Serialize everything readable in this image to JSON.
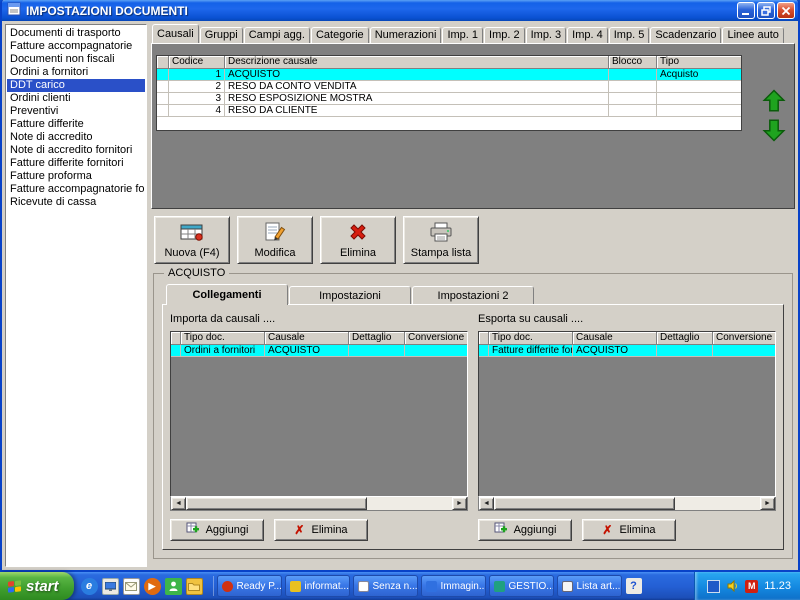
{
  "colors": {
    "selection_cyan": "#00ffff",
    "sidebar_selected_blue": "#2a50c8",
    "panel_gray": "#d4d0c8",
    "grid_empty_gray": "#808080",
    "titlebar_blue": "#1461e8",
    "arrow_green": "#1fa31f",
    "delete_red": "#c41200",
    "start_green": "#3f9e2e"
  },
  "window": {
    "title": "IMPOSTAZIONI DOCUMENTI"
  },
  "sidebar": {
    "selected_item": "DDT carico",
    "items": [
      "Documenti di trasporto",
      "Fatture accompagnatorie",
      "Documenti non fiscali",
      "Ordini a fornitori",
      "DDT carico",
      "Ordini clienti",
      "Preventivi",
      "Fatture differite",
      "Note di accredito",
      "Note di accredito fornitori",
      "Fatture differite fornitori",
      "Fatture proforma",
      "Fatture accompagnatorie fornitori",
      "Ricevute di cassa"
    ]
  },
  "tabs": {
    "active": "Causali",
    "items": [
      "Causali",
      "Gruppi",
      "Campi agg.",
      "Categorie",
      "Numerazioni",
      "Imp. 1",
      "Imp. 2",
      "Imp. 3",
      "Imp. 4",
      "Imp. 5",
      "Scadenzario",
      "Linee auto"
    ]
  },
  "main_table": {
    "columns": [
      "Codice",
      "Descrizione causale",
      "Blocco",
      "Tipo"
    ],
    "selected_row_descrizione": "ACQUISTO",
    "rows": [
      [
        "1",
        "ACQUISTO",
        "",
        "Acquisto"
      ],
      [
        "2",
        "RESO DA CONTO VENDITA",
        "",
        ""
      ],
      [
        "3",
        "RESO ESPOSIZIONE MOSTRA",
        "",
        ""
      ],
      [
        "4",
        "RESO DA CLIENTE",
        "",
        ""
      ]
    ]
  },
  "toolbar": {
    "buttons": [
      "Nuova (F4)",
      "Modifica",
      "Elimina",
      "Stampa lista"
    ]
  },
  "detail": {
    "group_title": "ACQUISTO",
    "active_tab": "Collegamenti",
    "tabs": [
      "Collegamenti",
      "Impostazioni",
      "Impostazioni 2"
    ],
    "columns": [
      "Tipo doc.",
      "Causale",
      "Dettaglio",
      "Conversione"
    ],
    "import_panel": {
      "title": "Importa da causali ....",
      "rows": [
        [
          "Ordini a fornitori",
          "ACQUISTO",
          "",
          ""
        ]
      ],
      "add_label": "Aggiungi",
      "delete_label": "Elimina"
    },
    "export_panel": {
      "title": "Esporta su causali ....",
      "rows": [
        [
          "Fatture differite for...",
          "ACQUISTO",
          "",
          ""
        ]
      ],
      "add_label": "Aggiungi",
      "delete_label": "Elimina"
    }
  },
  "taskbar": {
    "start_label": "start",
    "quick_launch_icons": [
      "internet-explorer",
      "show-desktop",
      "outlook-mail",
      "media-player",
      "messenger",
      "my-documents"
    ],
    "items": [
      "Ready P...",
      "informat...",
      "Senza n...",
      "Immagin...",
      "GESTIO...",
      "Lista art..."
    ],
    "tray_icons": [
      "network",
      "volume",
      "msn-alert"
    ],
    "time": "11.23"
  }
}
